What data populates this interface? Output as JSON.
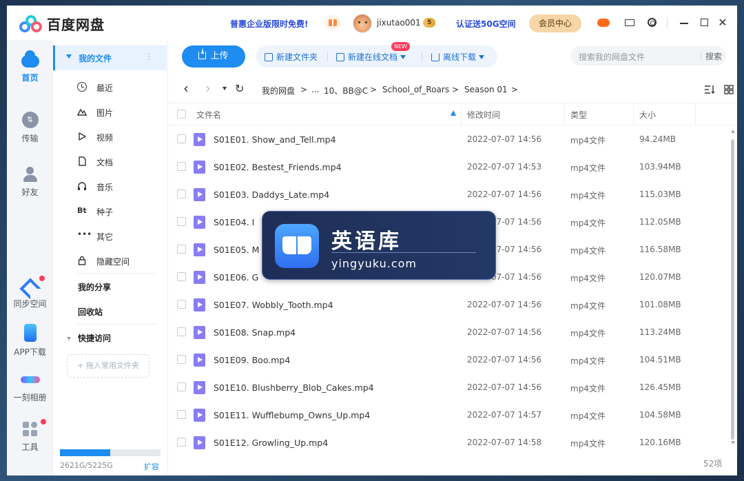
{
  "app": {
    "title": "百度网盘",
    "promo": "普惠企业版限时免费!",
    "username": "jixutao001",
    "vip_level": "5",
    "cert_promo": "认证送50G空间",
    "member_center": "会员中心",
    "close_glyph": "✕"
  },
  "leftnav": {
    "items": [
      {
        "label": "首页",
        "icon": "cloud-icon",
        "active": true
      },
      {
        "label": "传输",
        "icon": "transfer-icon"
      },
      {
        "label": "好友",
        "icon": "friends-icon"
      },
      {
        "label": "同步空间",
        "icon": "sync-icon",
        "badge": true
      },
      {
        "label": "APP下载",
        "icon": "phone-icon"
      },
      {
        "label": "一刻相册",
        "icon": "album-icon"
      },
      {
        "label": "工具",
        "icon": "tools-icon",
        "badge": true
      }
    ],
    "transfer_glyph": "⇅"
  },
  "sidebar": {
    "my_files": "我的文件",
    "more_glyph": "⋮",
    "categories": [
      {
        "label": "最近",
        "icon": "clock-icon"
      },
      {
        "label": "图片",
        "icon": "image-icon"
      },
      {
        "label": "视频",
        "icon": "video-icon"
      },
      {
        "label": "文档",
        "icon": "document-icon"
      },
      {
        "label": "音乐",
        "icon": "music-icon"
      },
      {
        "label": "种子",
        "icon": "bt-icon",
        "glyph": "Bt"
      },
      {
        "label": "其它",
        "icon": "more-icon",
        "glyph": "•••"
      },
      {
        "label": "隐藏空间",
        "icon": "lock-icon"
      }
    ],
    "my_share": "我的分享",
    "recycle": "回收站",
    "quick_access": "快捷访问",
    "drag_hint": "+ 拖入常用文件夹",
    "storage": {
      "text": "2621G/5225G",
      "used_fraction": 0.502
    },
    "expand": "扩容"
  },
  "toolbar": {
    "upload": "上传",
    "new_folder": "新建文件夹",
    "new_doc": "新建在线文档",
    "new_badge": "NEW",
    "offline_download": "离线下载",
    "search_placeholder": "搜索我的网盘文件",
    "search_button": "搜索"
  },
  "path": {
    "back": "‹",
    "forward": "›",
    "refresh": "↻",
    "crumbs": [
      "我的网盘",
      "...",
      "10、BB@C",
      "School_of_Roars",
      "Season 01"
    ],
    "separator": ">"
  },
  "table": {
    "columns": [
      "文件名",
      "修改时间",
      "类型",
      "大小"
    ],
    "rows": [
      {
        "name": "S01E01. Show_and_Tell.mp4",
        "time": "2022-07-07 14:56",
        "type": "mp4文件",
        "size": "94.24MB"
      },
      {
        "name": "S01E02. Bestest_Friends.mp4",
        "time": "2022-07-07 14:53",
        "type": "mp4文件",
        "size": "103.94MB"
      },
      {
        "name": "S01E03. Daddys_Late.mp4",
        "time": "2022-07-07 14:56",
        "type": "mp4文件",
        "size": "115.03MB"
      },
      {
        "name": "S01E04. I",
        "time": "2022-07-07 14:56",
        "type": "mp4文件",
        "size": "112.05MB"
      },
      {
        "name": "S01E05. M",
        "time": "2022-07-07 14:56",
        "type": "mp4文件",
        "size": "116.58MB"
      },
      {
        "name": "S01E06. G",
        "time": "2022-07-07 14:56",
        "type": "mp4文件",
        "size": "120.07MB"
      },
      {
        "name": "S01E07. Wobbly_Tooth.mp4",
        "time": "2022-07-07 14:56",
        "type": "mp4文件",
        "size": "101.08MB"
      },
      {
        "name": "S01E08. Snap.mp4",
        "time": "2022-07-07 14:56",
        "type": "mp4文件",
        "size": "113.24MB"
      },
      {
        "name": "S01E09. Boo.mp4",
        "time": "2022-07-07 14:56",
        "type": "mp4文件",
        "size": "104.51MB"
      },
      {
        "name": "S01E10. Blushberry_Blob_Cakes.mp4",
        "time": "2022-07-07 14:56",
        "type": "mp4文件",
        "size": "126.45MB"
      },
      {
        "name": "S01E11. Wufflebump_Owns_Up.mp4",
        "time": "2022-07-07 14:57",
        "type": "mp4文件",
        "size": "104.58MB"
      },
      {
        "name": "S01E12. Growling_Up.mp4",
        "time": "2022-07-07 14:58",
        "type": "mp4文件",
        "size": "120.16MB"
      }
    ],
    "count": "52项"
  },
  "watermark": {
    "cn": "英语库",
    "en": "yingyuku.com"
  },
  "colors": {
    "accent": "#1e8cf0",
    "promo_blue": "#2a4bd8",
    "video_icon": "#8a7cf5",
    "badge_red": "#ff3b5b"
  }
}
